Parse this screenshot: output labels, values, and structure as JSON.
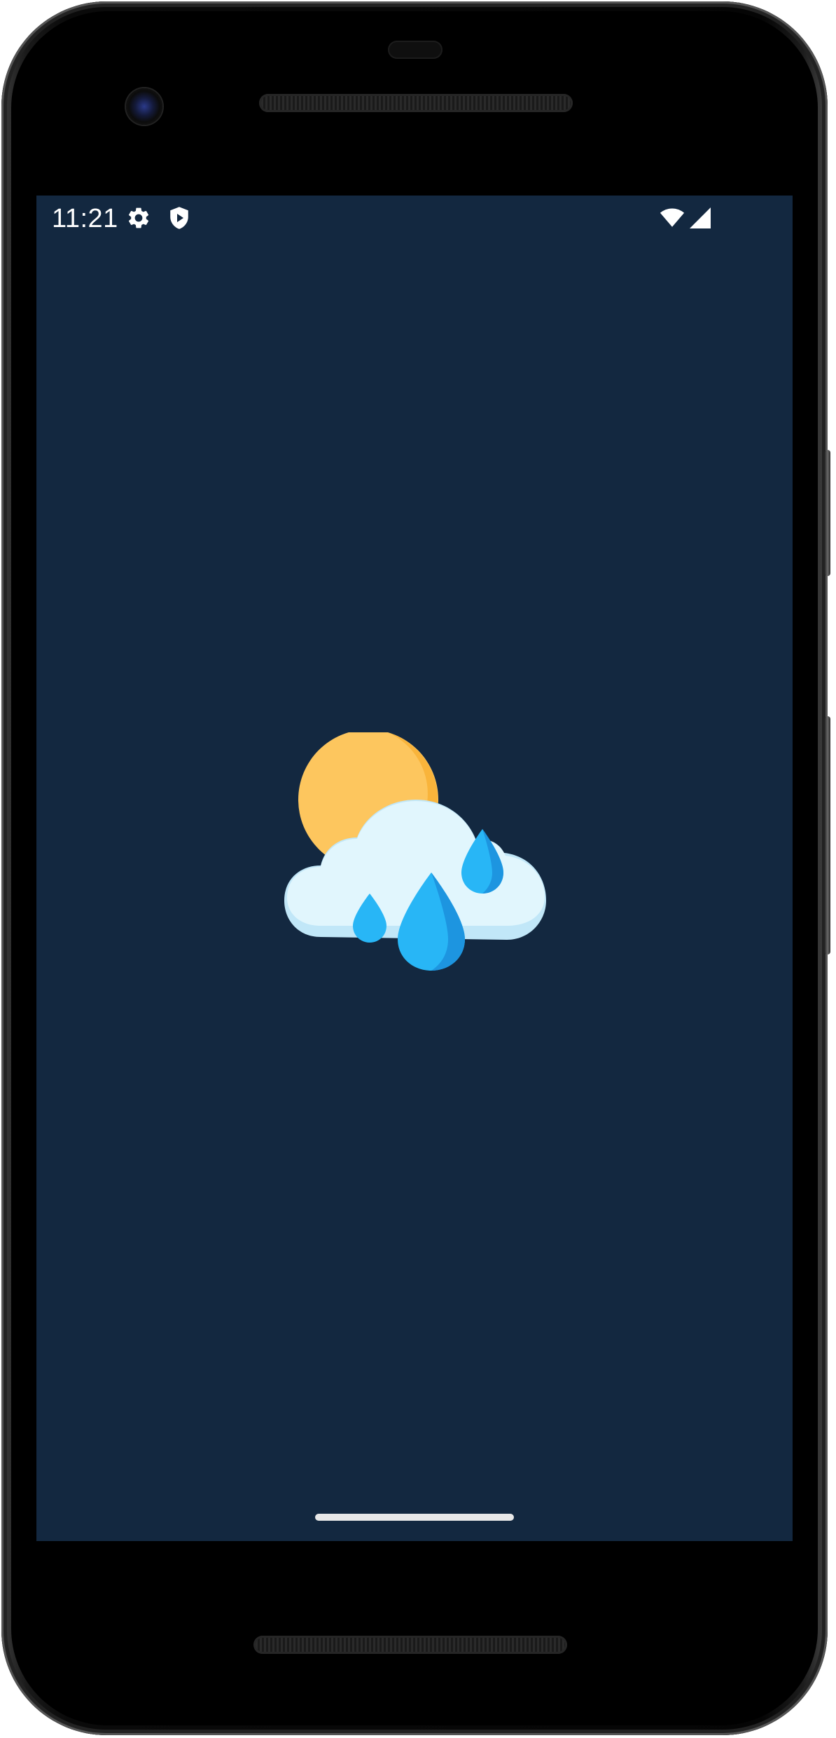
{
  "status_bar": {
    "time": "11:21",
    "left_icons": [
      "gear-icon",
      "shield-play-icon"
    ],
    "right_icons": [
      "wifi-icon",
      "cellular-signal-icon"
    ]
  },
  "screen": {
    "background_color": "#132840",
    "splash_icon": "sun-cloud-rain-icon"
  },
  "navigation": {
    "gesture_bar": "home-indicator"
  },
  "colors": {
    "sun": "#FDC65E",
    "sun_shade": "#F9B43B",
    "cloud": "#E1F6FD",
    "cloud_shade": "#C1E7F8",
    "drop": "#28B6F6",
    "drop_shade": "#1D95E0"
  }
}
